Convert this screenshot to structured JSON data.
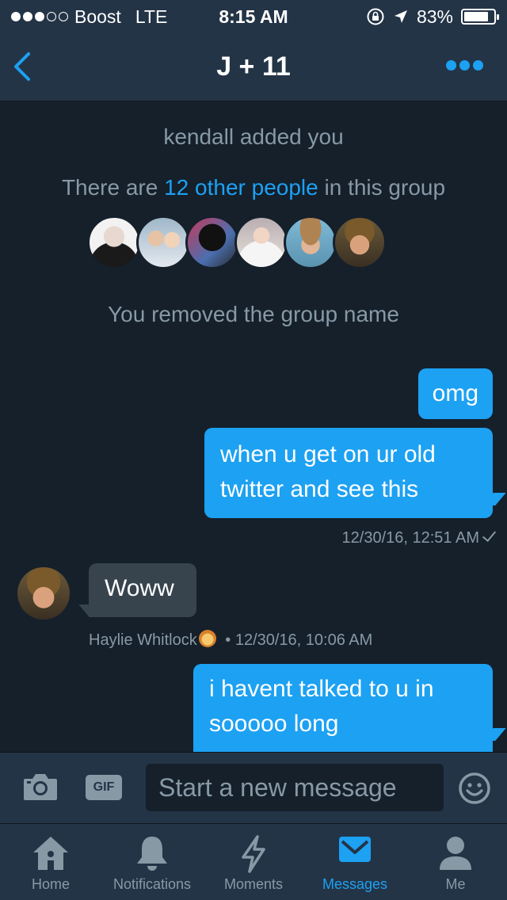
{
  "status_bar": {
    "carrier": "Boost",
    "network": "LTE",
    "time": "8:15 AM",
    "battery": "83%",
    "battery_level": 0.83,
    "signal_bars_filled": 3,
    "signal_bars_total": 5
  },
  "header": {
    "title": "J + 11"
  },
  "conversation": {
    "added_notice": "kendall added you",
    "group_info_prefix": "There are ",
    "group_info_link": "12 other people",
    "group_info_suffix": " in this group",
    "removed_notice": "You removed the group name",
    "messages": [
      {
        "text": "omg"
      },
      {
        "line1": "when u get on ur old",
        "line2": "twitter and see this"
      },
      {
        "text": "Woww"
      },
      {
        "line1": "i havent talked to u in",
        "line2": "sooooo long"
      }
    ],
    "sent_timestamp": "12/30/16, 12:51 AM",
    "received_sender": "Haylie Whitlock",
    "received_timestamp": "• 12/30/16, 10:06 AM"
  },
  "composer": {
    "gif_label": "GIF",
    "placeholder": "Start a new message"
  },
  "tabbar": {
    "items": [
      {
        "label": "Home"
      },
      {
        "label": "Notifications"
      },
      {
        "label": "Moments"
      },
      {
        "label": "Messages"
      },
      {
        "label": "Me"
      }
    ],
    "active": "Messages"
  },
  "colors": {
    "accent": "#1da1f2",
    "background": "#15202b",
    "bar": "#243447",
    "muted": "#8899a6",
    "incoming_bubble": "#38444d"
  }
}
